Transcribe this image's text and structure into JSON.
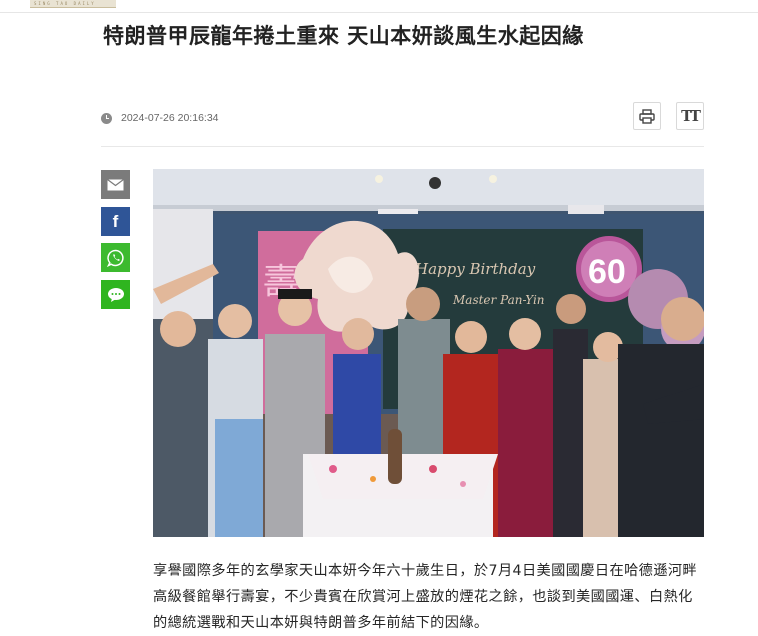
{
  "site": {
    "logo_text": "SING TAO DAILY"
  },
  "article": {
    "headline": "特朗普甲辰龍年捲土重來 天山本妍談風生水起因緣",
    "datetime": "2024-07-26 20:16:34",
    "body_lines": [
      "享譽國際多年的玄學家天山本妍今年六十歲生日，於7月4日美國國慶日在哈德遜河畔",
      "高級餐館舉行壽宴，不少貴賓在欣賞河上盛放的煙花之餘，也談到美國國運、白熱化",
      "的總統選戰和天山本妍與特朗普多年前結下的因緣。"
    ]
  },
  "toolbar": {
    "font_size_label": "TT"
  },
  "photo": {
    "banner_number": "60",
    "banner_script_1": "Happy Birthday",
    "banner_script_2": "Master Pan-Yin",
    "banner_char": "壽"
  },
  "colors": {
    "email": "#7b7b7b",
    "facebook": "#2f5597",
    "whatsapp": "#3cba2f",
    "line": "#2fb51f"
  }
}
